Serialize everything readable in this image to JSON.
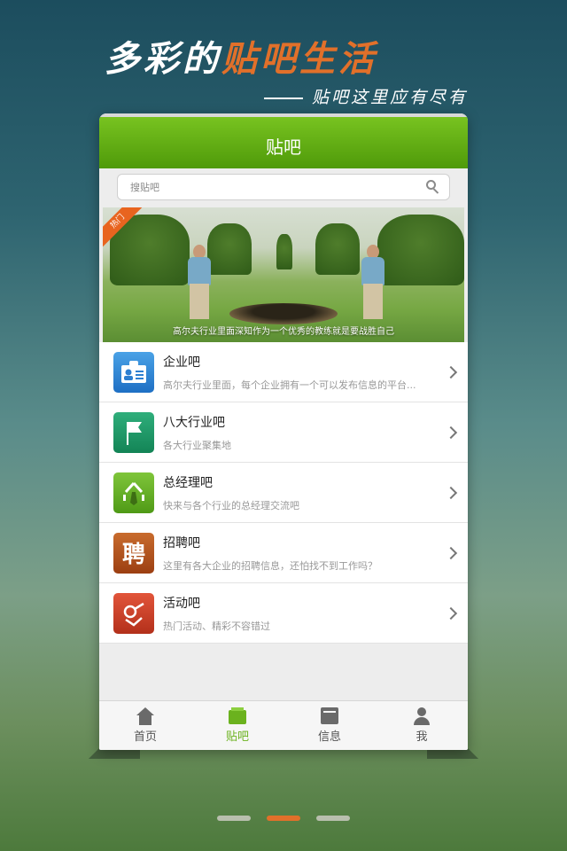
{
  "header": {
    "headline_plain": "多彩的",
    "headline_accent": "贴吧生活",
    "subline": "贴吧这里应有尽有"
  },
  "app": {
    "title": "贴吧",
    "search": {
      "placeholder": "搜贴吧",
      "value": ""
    },
    "banner": {
      "badge": "热门",
      "caption": "高尔夫行业里面深知作为一个优秀的教练就是要战胜自己"
    },
    "items": [
      {
        "title": "企业吧",
        "desc": "高尔夫行业里面，每个企业拥有一个可以发布信息的平台...",
        "icon": "id-card-icon"
      },
      {
        "title": "八大行业吧",
        "desc": "各大行业聚集地",
        "icon": "flag-icon"
      },
      {
        "title": "总经理吧",
        "desc": "快来与各个行业的总经理交流吧",
        "icon": "manager-icon",
        "glyph": "亽"
      },
      {
        "title": "招聘吧",
        "desc": "这里有各大企业的招聘信息，还怕找不到工作吗？",
        "icon": "recruit-icon",
        "glyph": "聘"
      },
      {
        "title": "活动吧",
        "desc": "热门活动、精彩不容错过",
        "icon": "activity-icon"
      }
    ],
    "tabs": [
      {
        "label": "首页",
        "icon": "home-icon",
        "active": false
      },
      {
        "label": "贴吧",
        "icon": "forum-icon",
        "active": true
      },
      {
        "label": "信息",
        "icon": "info-icon",
        "active": false
      },
      {
        "label": "我",
        "icon": "user-icon",
        "active": false
      }
    ]
  },
  "pager": {
    "pages": 3,
    "current": 2
  },
  "colors": {
    "accent": "#e1702a",
    "brand_green": "#5fa813"
  }
}
